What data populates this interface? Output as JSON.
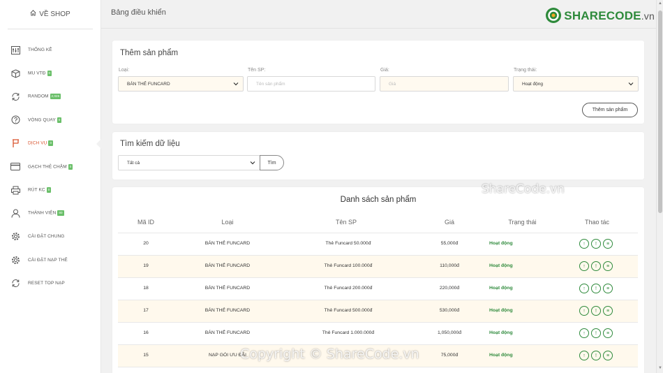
{
  "sidebar": {
    "shop_link": "VỀ SHOP",
    "items": [
      {
        "label": "THỐNG KÊ",
        "badge": "",
        "icon": "sliders-icon"
      },
      {
        "label": "MU VTĐ",
        "badge": "0",
        "icon": "box-icon"
      },
      {
        "label": "RANDOM",
        "badge": "2,026",
        "icon": "refresh-icon"
      },
      {
        "label": "VÒNG QUAY",
        "badge": "0",
        "icon": "question-circle-icon"
      },
      {
        "label": "DỊCH VỤ",
        "badge": "0",
        "icon": "flag-icon",
        "active": true
      },
      {
        "label": "GẠCH THẺ CHẬM",
        "badge": "0",
        "icon": "credit-card-icon"
      },
      {
        "label": "RÚT KC",
        "badge": "0",
        "icon": "printer-icon"
      },
      {
        "label": "THÀNH VIÊN",
        "badge": "80",
        "icon": "user-icon"
      },
      {
        "label": "CÀI ĐẶT CHUNG",
        "badge": "",
        "icon": "gear-icon"
      },
      {
        "label": "CÀI ĐẶT NẠP THẺ",
        "badge": "",
        "icon": "gear-icon"
      },
      {
        "label": "RESET TOP NẠP",
        "badge": "",
        "icon": "refresh-icon"
      }
    ]
  },
  "header": {
    "title": "Bảng điều khiển",
    "brand_main": "SHARECODE",
    "brand_suffix": ".vn"
  },
  "add_form": {
    "title": "Thêm sản phẩm",
    "type_label": "Loại:",
    "type_value": "BÁN THẺ FUNCARD",
    "name_label": "Tên SP:",
    "name_placeholder": "Tên sản phẩm",
    "price_label": "Giá:",
    "price_placeholder": "Giá",
    "status_label": "Trạng thái:",
    "status_value": "Hoạt động",
    "submit": "Thêm sản phẩm"
  },
  "search": {
    "title": "Tìm kiếm dữ liệu",
    "filter_value": "Tất cả",
    "button": "Tìm"
  },
  "table": {
    "title": "Danh sách sản phẩm",
    "headers": [
      "Mã ID",
      "Loại",
      "Tên SP",
      "Giá",
      "Trạng thái",
      "Thao tác"
    ],
    "rows": [
      {
        "id": "20",
        "type": "BÁN THẺ FUNCARD",
        "name": "Thẻ Funcard 50.000đ",
        "price": "55,000đ",
        "status": "Hoạt động"
      },
      {
        "id": "19",
        "type": "BÁN THẺ FUNCARD",
        "name": "Thẻ Funcard 100.000đ",
        "price": "110,000đ",
        "status": "Hoạt động"
      },
      {
        "id": "18",
        "type": "BÁN THẺ FUNCARD",
        "name": "Thẻ Funcard 200.000đ",
        "price": "220,000đ",
        "status": "Hoạt động"
      },
      {
        "id": "17",
        "type": "BÁN THẺ FUNCARD",
        "name": "Thẻ Funcard 500.000đ",
        "price": "530,000đ",
        "status": "Hoạt động"
      },
      {
        "id": "16",
        "type": "BÁN THẺ FUNCARD",
        "name": "Thẻ Funcard 1.000.000đ",
        "price": "1,050,000đ",
        "status": "Hoạt động"
      },
      {
        "id": "15",
        "type": "NẠP GÓI ƯU ĐÃI",
        "name": "",
        "price": "75,000đ",
        "status": "Hoạt động"
      }
    ]
  },
  "watermarks": {
    "top": "ShareCode.vn",
    "bottom": "Copyright © ShareCode.vn"
  }
}
